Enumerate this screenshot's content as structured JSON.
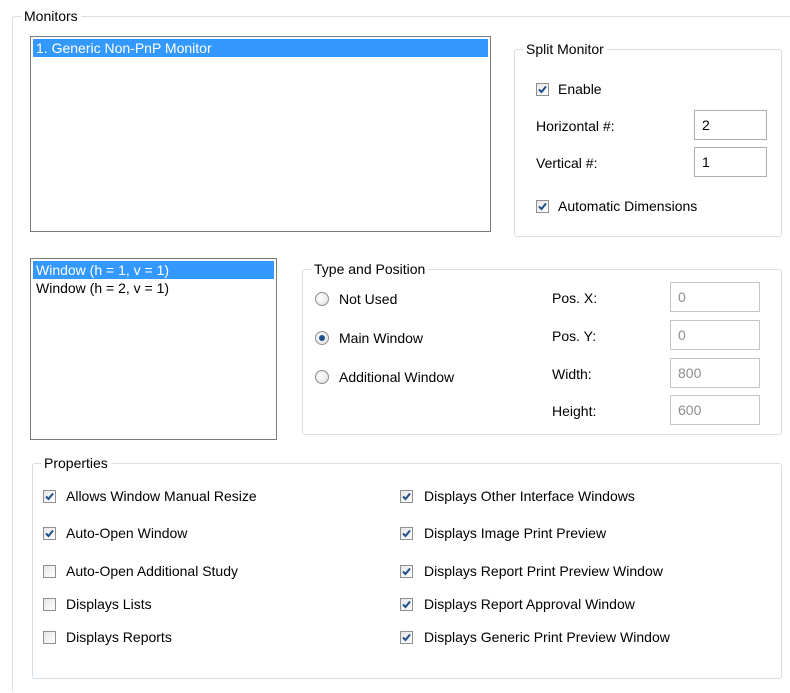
{
  "monitors": {
    "title": "Monitors",
    "list": [
      "1. Generic Non-PnP Monitor"
    ],
    "split": {
      "title": "Split Monitor",
      "enable_label": "Enable",
      "enable_checked": true,
      "horizontal_label": "Horizontal #:",
      "horizontal_value": "2",
      "vertical_label": "Vertical #:",
      "vertical_value": "1",
      "auto_dim_label": "Automatic Dimensions",
      "auto_dim_checked": true
    }
  },
  "windows": {
    "list": [
      "Window (h = 1, v = 1)",
      "Window (h = 2, v = 1)"
    ]
  },
  "type_position": {
    "title": "Type and Position",
    "options": [
      "Not Used",
      "Main Window",
      "Additional Window"
    ],
    "selected": "Main Window",
    "pos_x_label": "Pos. X:",
    "pos_x_value": "0",
    "pos_y_label": "Pos. Y:",
    "pos_y_value": "0",
    "width_label": "Width:",
    "width_value": "800",
    "height_label": "Height:",
    "height_value": "600"
  },
  "properties": {
    "title": "Properties",
    "left": [
      {
        "label": "Allows Window Manual Resize",
        "checked": true
      },
      {
        "label": "Auto-Open Window",
        "checked": true
      },
      {
        "label": "Auto-Open Additional Study",
        "checked": false
      },
      {
        "label": "Displays Lists",
        "checked": false
      },
      {
        "label": "Displays Reports",
        "checked": false
      }
    ],
    "right": [
      {
        "label": "Displays Other Interface Windows",
        "checked": true
      },
      {
        "label": "Displays Image Print Preview",
        "checked": true
      },
      {
        "label": "Displays Report Print Preview Window",
        "checked": true
      },
      {
        "label": "Displays Report Approval Window",
        "checked": true
      },
      {
        "label": "Displays Generic Print Preview Window",
        "checked": true
      }
    ]
  },
  "colors": {
    "selection": "#3399ff",
    "group_border": "#d5dfe5",
    "check_mark": "#1d4f8a"
  }
}
